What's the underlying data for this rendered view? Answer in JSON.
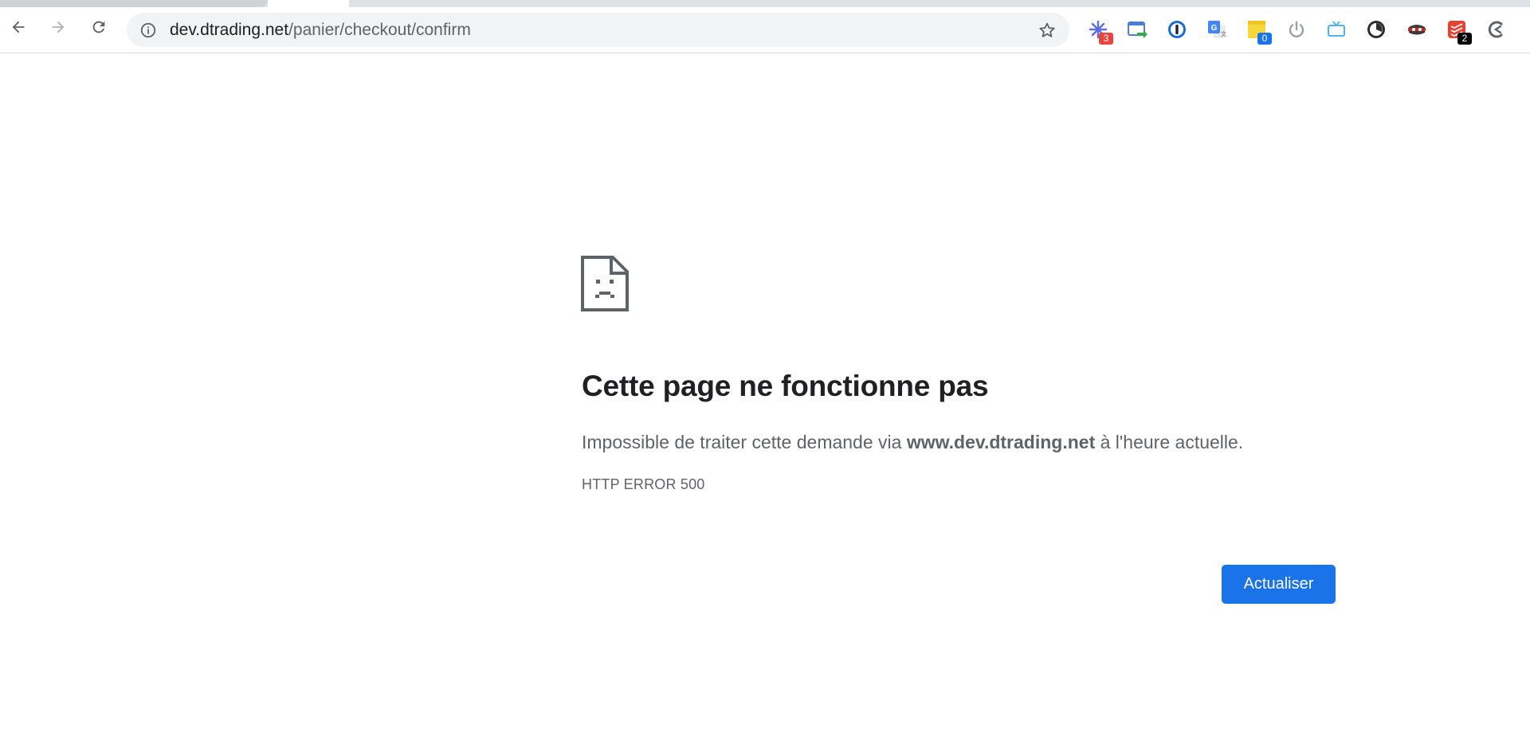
{
  "browser": {
    "url_host": "dev.dtrading.net",
    "url_path": "/panier/checkout/confirm",
    "nav": {
      "back_icon": "arrow-back-icon",
      "forward_icon": "arrow-forward-icon",
      "reload_icon": "reload-icon"
    },
    "extensions": [
      {
        "name": "asterisk-extension-icon",
        "badge": "3",
        "badge_color": "#e8453c"
      },
      {
        "name": "screen-share-extension-icon",
        "badge": ""
      },
      {
        "name": "onepassword-icon",
        "badge": ""
      },
      {
        "name": "google-translate-icon",
        "badge": ""
      },
      {
        "name": "sticky-notes-icon",
        "badge": "0",
        "badge_color": "#1a73e8"
      },
      {
        "name": "power-icon",
        "badge": ""
      },
      {
        "name": "tv-icon",
        "badge": ""
      },
      {
        "name": "timer-icon",
        "badge": ""
      },
      {
        "name": "incognito-mask-icon",
        "badge": ""
      },
      {
        "name": "todoist-icon",
        "badge": "2",
        "badge_color": "#000000"
      },
      {
        "name": "crescent-c-icon",
        "badge": ""
      }
    ]
  },
  "error_page": {
    "icon": "sad-page-icon",
    "title": "Cette page ne fonctionne pas",
    "desc_prefix": "Impossible de traiter cette demande via ",
    "desc_host": "www.dev.dtrading.net",
    "desc_suffix": " à l'heure actuelle.",
    "error_code": "HTTP ERROR 500",
    "reload_label": "Actualiser"
  },
  "colors": {
    "accent": "#1a73e8",
    "text_primary": "#202124",
    "text_secondary": "#5f6368",
    "omnibox_bg": "#f1f3f4"
  }
}
